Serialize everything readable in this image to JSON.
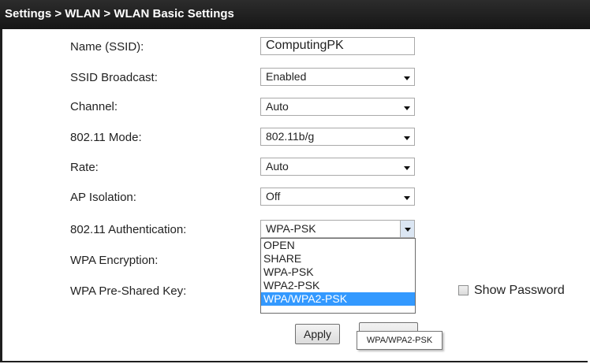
{
  "breadcrumb": "Settings > WLAN > WLAN Basic Settings",
  "form": {
    "ssid_label": "Name (SSID):",
    "ssid_value": "ComputingPK",
    "broadcast_label": "SSID Broadcast:",
    "broadcast_value": "Enabled",
    "channel_label": "Channel:",
    "channel_value": "Auto",
    "mode_label": "802.11 Mode:",
    "mode_value": "802.11b/g",
    "rate_label": "Rate:",
    "rate_value": "Auto",
    "isolation_label": "AP Isolation:",
    "isolation_value": "Off",
    "auth_label": "802.11 Authentication:",
    "auth_value": "WPA-PSK",
    "encryption_label": "WPA Encryption:",
    "psk_label": "WPA Pre-Shared Key:",
    "show_password_label": "Show Password"
  },
  "auth_options": [
    {
      "label": "OPEN",
      "selected": false
    },
    {
      "label": "SHARE",
      "selected": false
    },
    {
      "label": "WPA-PSK",
      "selected": false
    },
    {
      "label": "WPA2-PSK",
      "selected": false
    },
    {
      "label": "WPA/WPA2-PSK",
      "selected": true
    }
  ],
  "buttons": {
    "apply": "Apply"
  },
  "tooltip": "WPA/WPA2-PSK",
  "colors": {
    "titlebar": "#1e1e1e",
    "highlight": "#3399ff"
  }
}
